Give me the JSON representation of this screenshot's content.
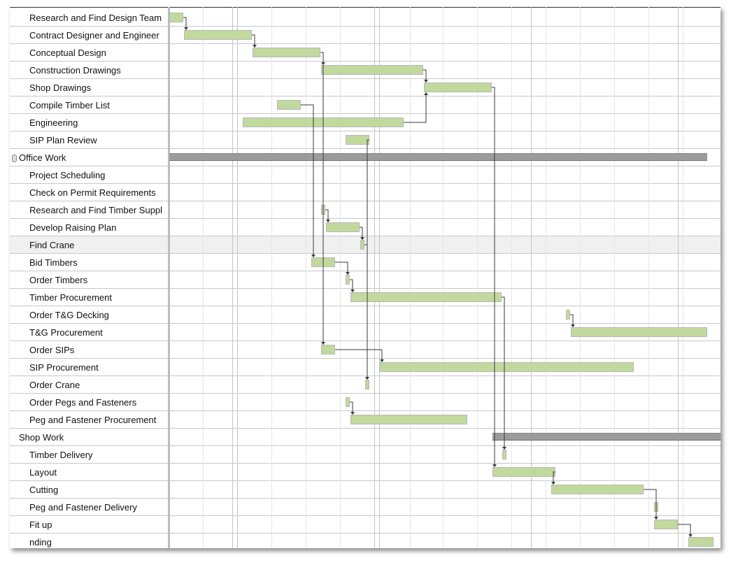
{
  "tasks": [
    {
      "name": "Research and Find Design Team",
      "level": 1,
      "bar": [
        242,
        262
      ]
    },
    {
      "name": "Contract Designer and Engineer",
      "level": 1,
      "bar": [
        263,
        360
      ]
    },
    {
      "name": "Conceptual Design",
      "level": 1,
      "bar": [
        361,
        458
      ]
    },
    {
      "name": "Construction Drawings",
      "level": 1,
      "bar": [
        459,
        605
      ]
    },
    {
      "name": "Shop Drawings",
      "level": 1,
      "bar": [
        606,
        703
      ]
    },
    {
      "name": "Compile Timber List",
      "level": 1,
      "bar": [
        396,
        430
      ]
    },
    {
      "name": "Engineering",
      "level": 1,
      "bar": [
        347,
        577
      ]
    },
    {
      "name": "SIP Plan Review",
      "level": 1,
      "bar": [
        494,
        528
      ]
    },
    {
      "name": "Office Work",
      "level": 0,
      "summary": true,
      "collapsible": true,
      "bar": [
        242,
        1011
      ]
    },
    {
      "name": "Project Scheduling",
      "level": 1
    },
    {
      "name": "Check on Permit Requirements",
      "level": 1
    },
    {
      "name": "Research and Find Timber Suppl",
      "level": 1,
      "bar": [
        459,
        465
      ]
    },
    {
      "name": "Develop Raising Plan",
      "level": 1,
      "bar": [
        466,
        514
      ]
    },
    {
      "name": "Find Crane",
      "level": 1,
      "selected": true,
      "bar": [
        515,
        521
      ]
    },
    {
      "name": "Bid Timbers",
      "level": 1,
      "bar": [
        445,
        479
      ]
    },
    {
      "name": "Order Timbers",
      "level": 1,
      "bar": [
        494,
        500
      ]
    },
    {
      "name": "Timber Procurement",
      "level": 1,
      "bar": [
        501,
        717
      ]
    },
    {
      "name": "Order T&G Decking",
      "level": 1,
      "bar": [
        809,
        815
      ]
    },
    {
      "name": "T&G Procurement",
      "level": 1,
      "bar": [
        816,
        1011
      ]
    },
    {
      "name": "Order SIPs",
      "level": 1,
      "bar": [
        459,
        479
      ]
    },
    {
      "name": "SIP Procurement",
      "level": 1,
      "bar": [
        543,
        906
      ]
    },
    {
      "name": "Order Crane",
      "level": 1,
      "bar": [
        522,
        528
      ]
    },
    {
      "name": "Order Pegs and Fasteners",
      "level": 1,
      "bar": [
        494,
        500
      ]
    },
    {
      "name": "Peg and Fastener Procurement",
      "level": 1,
      "bar": [
        501,
        668
      ]
    },
    {
      "name": "Shop Work",
      "level": 0,
      "summary": true,
      "bar": [
        704,
        1040
      ]
    },
    {
      "name": "Timber Delivery",
      "level": 1,
      "bar": [
        718,
        724
      ]
    },
    {
      "name": "Layout",
      "level": 1,
      "bar": [
        704,
        794
      ]
    },
    {
      "name": "Cutting",
      "level": 1,
      "bar": [
        788,
        920
      ]
    },
    {
      "name": "Peg and Fastener Delivery",
      "level": 1,
      "bar": [
        935,
        941
      ]
    },
    {
      "name": "Fit up",
      "level": 1,
      "bar": [
        935,
        969
      ]
    },
    {
      "name": "nding",
      "level": 1,
      "bar": [
        984,
        1020
      ]
    }
  ],
  "links": [
    [
      0,
      1
    ],
    [
      1,
      2
    ],
    [
      2,
      3
    ],
    [
      3,
      4
    ],
    [
      6,
      4
    ],
    [
      5,
      14
    ],
    [
      2,
      19
    ],
    [
      7,
      21
    ],
    [
      11,
      12
    ],
    [
      12,
      13
    ],
    [
      13,
      21
    ],
    [
      14,
      15
    ],
    [
      15,
      16
    ],
    [
      19,
      20
    ],
    [
      22,
      23
    ],
    [
      17,
      18
    ],
    [
      16,
      25
    ],
    [
      4,
      26
    ],
    [
      26,
      27
    ],
    [
      27,
      29
    ],
    [
      29,
      30
    ]
  ],
  "colors": {
    "task_bar": "#c2d99e",
    "summary_bar": "#9c9c9c",
    "link_line": "#3a3a3a",
    "selected_row": "#f0f0f0"
  }
}
